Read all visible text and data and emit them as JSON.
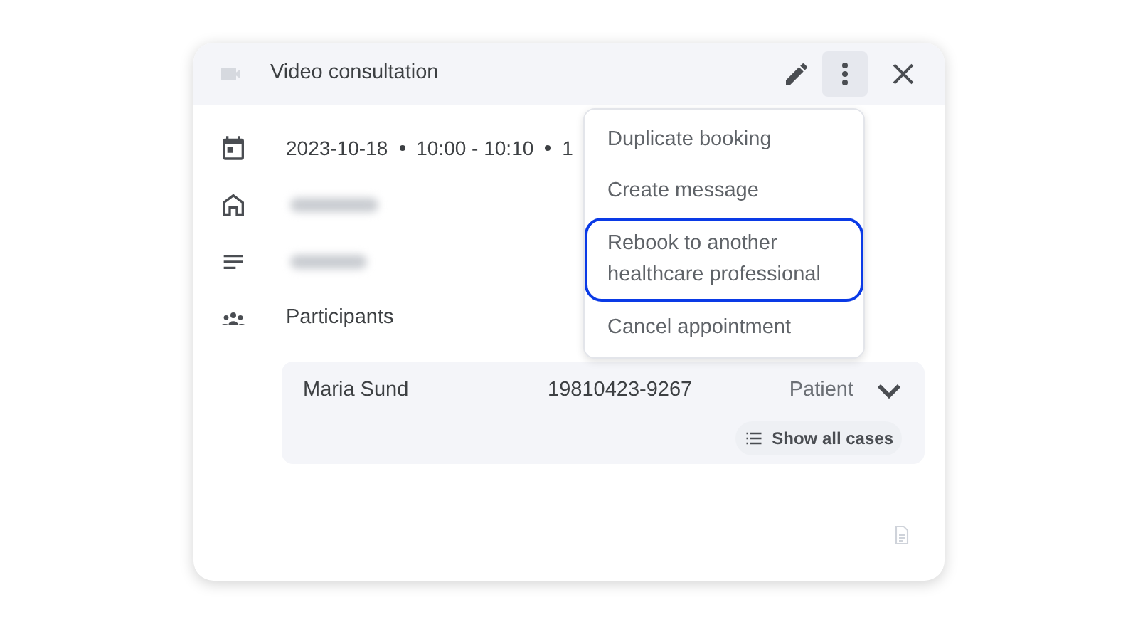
{
  "dialog": {
    "title": "Video consultation",
    "date_parts": [
      "2023-10-18",
      "10:00 - 10:10",
      "1"
    ]
  },
  "menu": {
    "items": [
      {
        "label": "Duplicate booking",
        "selected": false
      },
      {
        "label": "Create message",
        "selected": false
      },
      {
        "label": "Rebook to another healthcare professional",
        "selected": true
      },
      {
        "label": "Cancel appointment",
        "selected": false
      }
    ]
  },
  "participants": {
    "heading": "Participants",
    "rows": [
      {
        "name": "Maria Sund",
        "id_number": "19810423-9267",
        "role": "Patient",
        "expanded": false,
        "action": "Show all cases"
      }
    ]
  }
}
